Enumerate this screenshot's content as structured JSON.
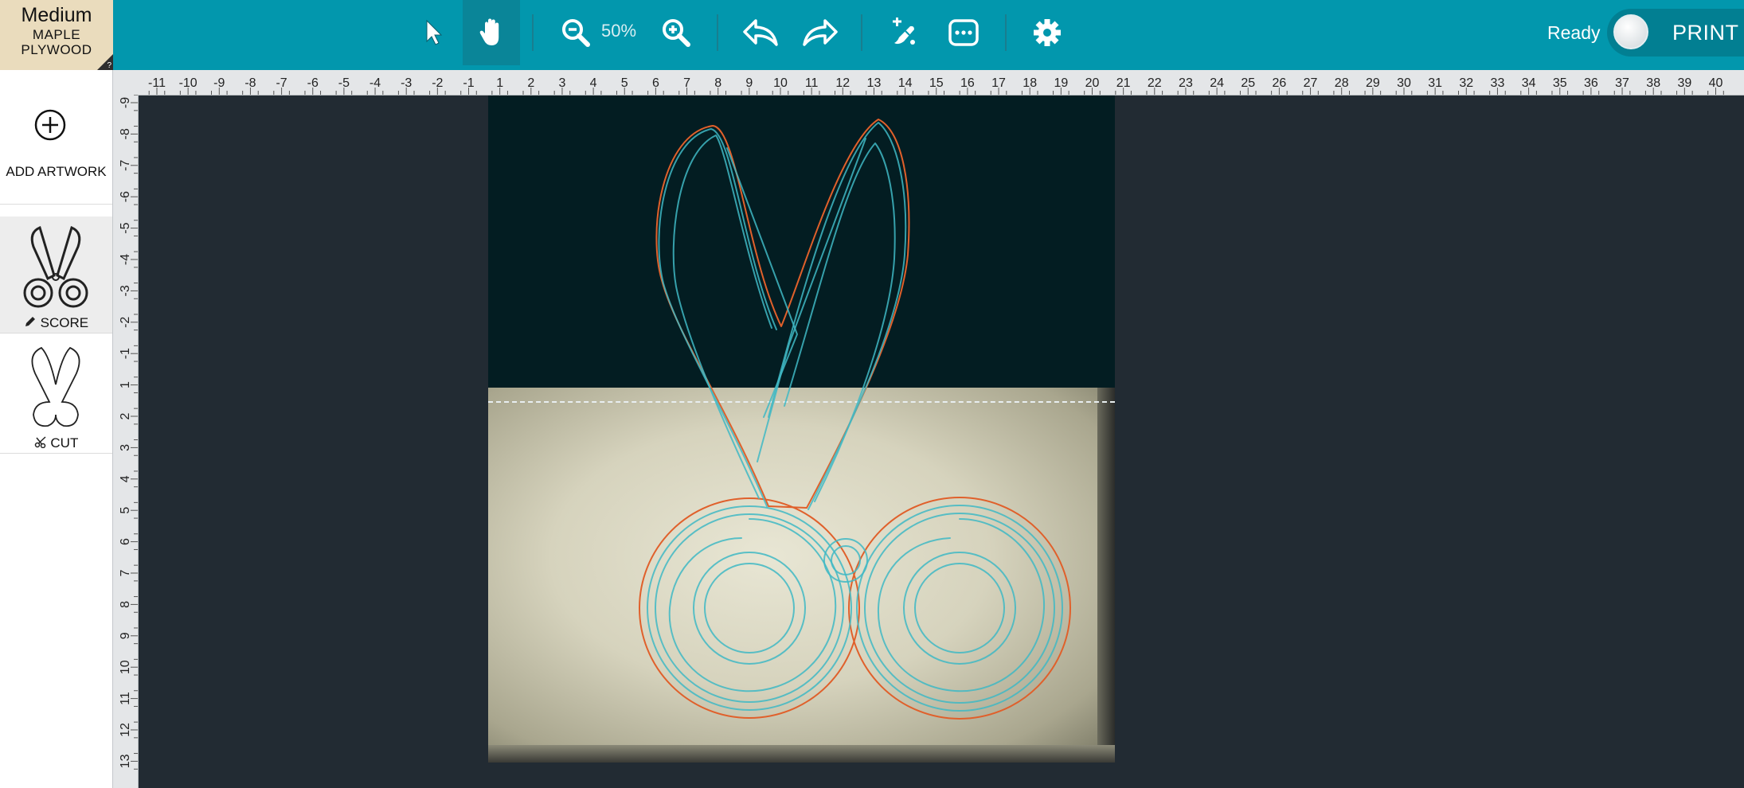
{
  "material": {
    "size": "Medium",
    "line1": "MAPLE",
    "line2": "PLYWOOD",
    "help": "?"
  },
  "toolbar": {
    "zoom_level": "50%",
    "status": "Ready",
    "print_label": "PRINT",
    "tools": [
      "select-arrow-icon",
      "hand-icon",
      "zoom-out-icon",
      "zoom-in-icon",
      "undo-icon",
      "redo-icon",
      "magic-tool-icon",
      "more-icon",
      "gear-icon"
    ]
  },
  "sidebar": {
    "add_artwork": "ADD ARTWORK",
    "layers": [
      {
        "label": "SCORE",
        "icon": "pencil-icon"
      },
      {
        "label": "CUT",
        "icon": "scissors-icon"
      }
    ]
  },
  "ruler": {
    "horizontal": [
      "-11",
      "-10",
      "-9",
      "-8",
      "-7",
      "-6",
      "-5",
      "-4",
      "-3",
      "-2",
      "-1",
      "1",
      "2",
      "3",
      "4",
      "5",
      "6",
      "7",
      "8",
      "9",
      "10",
      "11",
      "12",
      "13",
      "14",
      "15",
      "16",
      "17",
      "18",
      "19",
      "20",
      "21",
      "22",
      "23",
      "24",
      "25",
      "26",
      "27",
      "28",
      "29",
      "30",
      "31",
      "32",
      "33",
      "34",
      "35",
      "36",
      "37",
      "38",
      "39",
      "40"
    ],
    "vertical": [
      "-9",
      "-8",
      "-7",
      "-6",
      "-5",
      "-4",
      "-3",
      "-2",
      "-1",
      "1",
      "2",
      "3",
      "4",
      "5",
      "6",
      "7",
      "8",
      "9",
      "10",
      "11",
      "12",
      "13"
    ]
  },
  "colors": {
    "topbar": "#0297ad",
    "score_line": "#3fb9c4",
    "cut_line": "#e0602b",
    "canvas_bg": "#222b33",
    "bed_dark": "#031d22"
  }
}
